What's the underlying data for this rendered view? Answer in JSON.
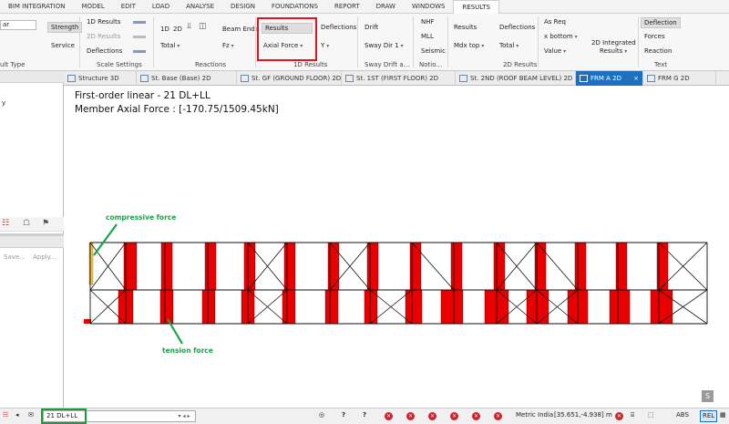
{
  "menubar": {
    "tabs": [
      "BIM INTEGRATION",
      "MODEL",
      "EDIT",
      "LOAD",
      "ANALYSE",
      "DESIGN",
      "FOUNDATIONS",
      "REPORT",
      "DRAW",
      "WINDOWS",
      "RESULTS"
    ],
    "active": "RESULTS"
  },
  "ribbon": {
    "left_combo": "ar",
    "strength": "Strength",
    "service": "Service",
    "result_type_group": "ult Type",
    "results_1d": "1D Results",
    "results_2d": "2D Results",
    "deflections_toggle": "Deflections",
    "scale_settings_group": "Scale Settings",
    "dim_1d": "1D",
    "dim_2d": "2D",
    "total": "Total",
    "beam_ends": "Beam Ends",
    "fz": "Fz",
    "reactions_group": "Reactions",
    "results_btn": "Results",
    "axial_force": "Axial Force",
    "deflections": "Deflections",
    "y": "Y",
    "results_1d_group": "1D Results",
    "drift": "Drift",
    "sway_dir": "Sway Dir 1",
    "sway_group": "Sway Drift a...",
    "nhf": "NHF",
    "mll": "MLL",
    "seismic": "Seismic",
    "notional_group": "Notio...",
    "results_2d_btn": "Results",
    "mdx_top": "Mdx top",
    "deflections_2d": "Deflections",
    "total_2d": "Total",
    "results_2d_group": "2D Results",
    "as_req": "As Req",
    "x_bottom": "x bottom",
    "value": "Value",
    "integrated_line1": "2D Integrated",
    "integrated_line2": "Results",
    "deflection_text": "Deflection",
    "forces_text": "Forces",
    "reaction_text": "Reaction",
    "text_group": "Text"
  },
  "left_panel": {
    "fragment": "y",
    "save": "Save...",
    "apply": "Apply..."
  },
  "view_tabs": [
    {
      "label": "Structure 3D",
      "active": false
    },
    {
      "label": "St. Base (Base) 2D",
      "active": false
    },
    {
      "label": "St. GF (GROUND FLOOR) 2D",
      "active": false
    },
    {
      "label": "St. 1ST (FIRST FLOOR) 2D",
      "active": false
    },
    {
      "label": "St. 2ND (ROOF BEAM LEVEL) 2D",
      "active": false
    },
    {
      "label": "FRM A 2D",
      "active": true
    },
    {
      "label": "FRM G 2D",
      "active": false
    }
  ],
  "canvas": {
    "title_line1": "First-order linear - 21 DL+LL",
    "title_line2": "Member Axial Force : [-170.75/1509.45kN]",
    "annot_compressive": "compressive force",
    "annot_tension": "tension force",
    "corner_label": "S"
  },
  "colors": {
    "tension": "#ea0000",
    "compression": "#f2c744",
    "annotation": "#19a34a",
    "highlight_red": "#e0141a",
    "highlight_green": "#1a9c3c",
    "accent": "#1e6fbf"
  },
  "statusbar": {
    "load_combo": "21 DL+LL",
    "metric": "Metric",
    "region": "India",
    "coords": "[35.651,-4.938] m",
    "abs": "ABS",
    "rel": "REL"
  }
}
